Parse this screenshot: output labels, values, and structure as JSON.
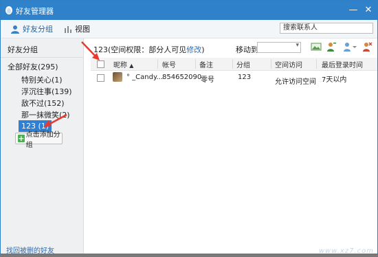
{
  "window": {
    "title": "好友管理器"
  },
  "toolbar": {
    "friends_group_label": "好友分组",
    "view_label": "视图",
    "search_placeholder": "搜索联系人"
  },
  "sidebar": {
    "header": "好友分组",
    "all_friends": "全部好友(295)",
    "groups": [
      {
        "label": "特别关心(1)"
      },
      {
        "label": "浮沉往事(139)"
      },
      {
        "label": "敌不过(152)"
      },
      {
        "label": "那一抹微笑(2)"
      }
    ],
    "selected_group": "123 (1)",
    "add_group_label": "点击添加分组",
    "recover_link": "找回被删的好友"
  },
  "main": {
    "group_info": "123(空间权限：部分人可见",
    "modify_link": "修改",
    "close_paren": ")",
    "move_to_label": "移动到",
    "columns": [
      "昵称",
      "帐号",
      "备注",
      "分组",
      "空间访问",
      "最后登录时间"
    ],
    "sort_arrow": "▲",
    "rows": [
      {
        "nickname": "° _Candy...",
        "account": "854652090",
        "remark": "零号",
        "group": "123",
        "space_access": "允许访问空间",
        "last_login": "7天以内"
      }
    ]
  },
  "watermark": "www.xz7.com",
  "colors": {
    "titlebar": "#2f82c9",
    "selected": "#2f7fd2",
    "link": "#2f6db5",
    "annotation": "#e8392b"
  }
}
